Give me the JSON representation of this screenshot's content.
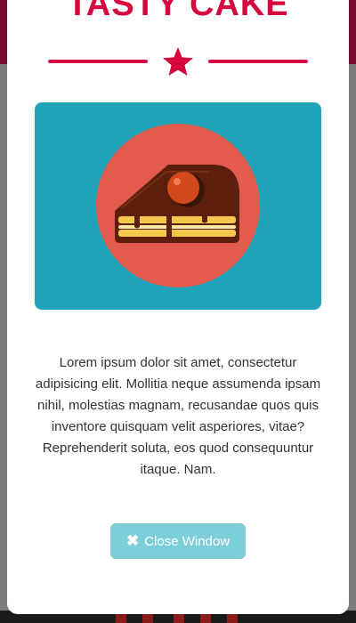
{
  "modal": {
    "title": "TASTY CAKE",
    "body_text": "Lorem ipsum dolor sit amet, consectetur adipisicing elit. Mollitia neque assumenda ipsam nihil, molestias magnam, recusandae quos quis inventore quisquam velit asperiores, vitae? Reprehenderit soluta, eos quod consequuntur itaque. Nam.",
    "close_button_label": "Close Window",
    "close_icon": "close-icon",
    "divider_icon": "star-icon",
    "image_icon": "cake-slice-icon"
  },
  "colors": {
    "accent": "#d6063f",
    "image_background": "#20a2b8",
    "image_circle": "#e35b4c",
    "button": "#7ccfd8",
    "overlay": "#7c7c7c"
  }
}
